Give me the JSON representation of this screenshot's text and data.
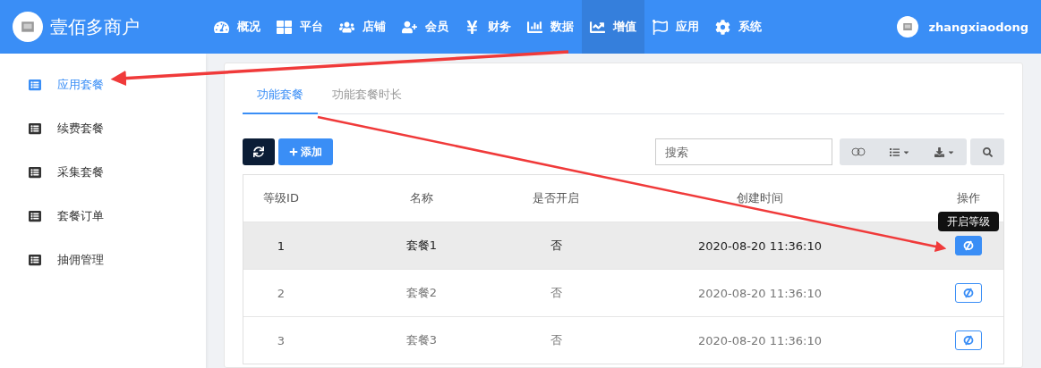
{
  "header": {
    "brand": "壹佰多商户",
    "user": "zhangxiaodong"
  },
  "nav": [
    {
      "label": "概况",
      "selected": false
    },
    {
      "label": "平台",
      "selected": false
    },
    {
      "label": "店铺",
      "selected": false
    },
    {
      "label": "会员",
      "selected": false
    },
    {
      "label": "财务",
      "selected": false
    },
    {
      "label": "数据",
      "selected": false
    },
    {
      "label": "增值",
      "selected": true
    },
    {
      "label": "应用",
      "selected": false
    },
    {
      "label": "系统",
      "selected": false
    }
  ],
  "sidebar": {
    "items": [
      {
        "label": "应用套餐",
        "selected": true
      },
      {
        "label": "续费套餐",
        "selected": false
      },
      {
        "label": "采集套餐",
        "selected": false
      },
      {
        "label": "套餐订单",
        "selected": false
      },
      {
        "label": "抽佣管理",
        "selected": false
      }
    ]
  },
  "tabs": [
    {
      "label": "功能套餐",
      "selected": true
    },
    {
      "label": "功能套餐时长",
      "selected": false
    }
  ],
  "toolbar": {
    "add_button": "添加",
    "search": {
      "placeholder": "搜索"
    }
  },
  "table": {
    "columns": [
      "等级ID",
      "名称",
      "是否开启",
      "创建时间",
      "操作"
    ],
    "rows": [
      {
        "cells": [
          "1",
          "套餐1",
          "否",
          "2020-08-20 11:36:10"
        ],
        "selected": true,
        "tooltip": "开启等级"
      },
      {
        "cells": [
          "2",
          "套餐2",
          "否",
          "2020-08-20 11:36:10"
        ],
        "selected": false
      },
      {
        "cells": [
          "3",
          "套餐3",
          "否",
          "2020-08-20 11:36:10"
        ],
        "selected": false
      }
    ]
  }
}
